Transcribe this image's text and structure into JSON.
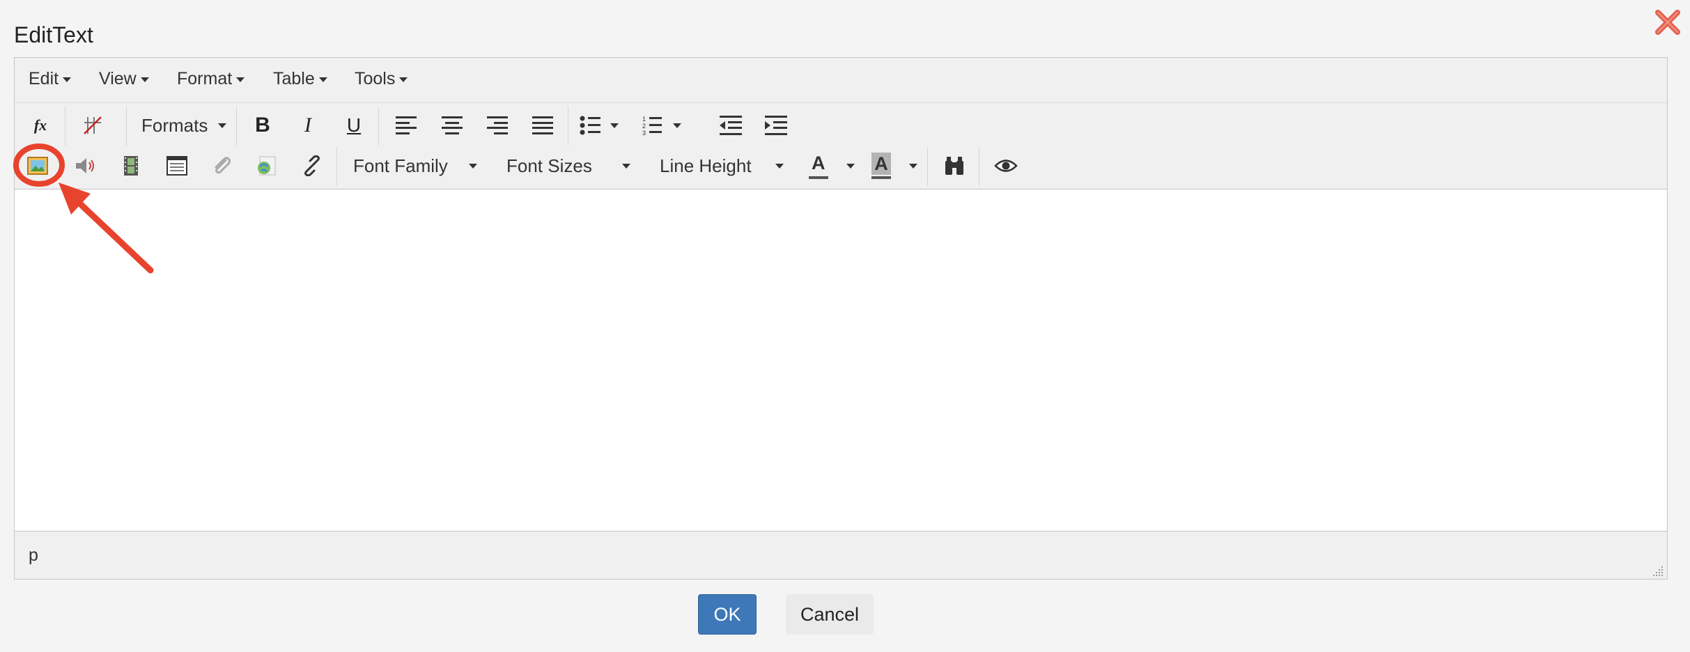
{
  "dialog": {
    "title": "EditText"
  },
  "menubar": {
    "edit": "Edit",
    "view": "View",
    "format": "Format",
    "table": "Table",
    "tools": "Tools"
  },
  "toolbar1": {
    "formula_label": "fx",
    "formats": "Formats",
    "bold_label": "B",
    "italic_label": "I",
    "underline_label": "U"
  },
  "toolbar2": {
    "font_family": "Font Family",
    "font_sizes": "Font Sizes",
    "line_height": "Line Height",
    "text_color_label": "A",
    "bg_color_label": "A"
  },
  "statusbar": {
    "path": "p"
  },
  "buttons": {
    "ok": "OK",
    "cancel": "Cancel"
  },
  "colors": {
    "accent": "#3e78b8",
    "annotation": "#e8432d"
  }
}
